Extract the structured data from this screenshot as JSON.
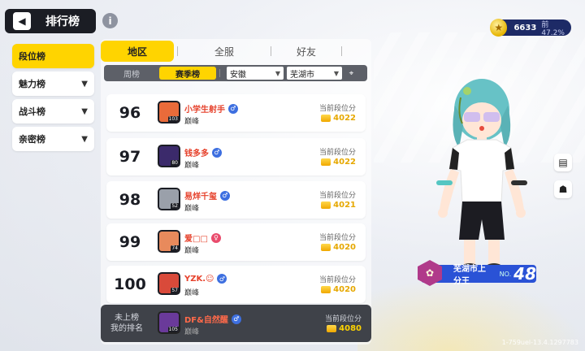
{
  "header": {
    "title": "排行榜",
    "back_icon": "arrow-left-icon",
    "info_icon": "info-icon"
  },
  "categories": [
    {
      "label": "段位榜",
      "active": true,
      "has_dropdown": false
    },
    {
      "label": "魅力榜",
      "active": false,
      "has_dropdown": true
    },
    {
      "label": "战斗榜",
      "active": false,
      "has_dropdown": true
    },
    {
      "label": "亲密榜",
      "active": false,
      "has_dropdown": true
    }
  ],
  "tabs": [
    {
      "label": "地区",
      "active": true
    },
    {
      "label": "全服",
      "active": false
    },
    {
      "label": "好友",
      "active": false
    }
  ],
  "filters": {
    "period": [
      {
        "label": "周榜",
        "active": false
      },
      {
        "label": "赛季榜",
        "active": true
      }
    ],
    "province": "安徽",
    "city": "芜湖市",
    "location_icon": "location-pin-icon"
  },
  "score_label": "当前段位分",
  "rows": [
    {
      "rank": "96",
      "name": "小学生射手",
      "gender": "male",
      "tier": "巅峰",
      "score": "4022",
      "level": "103",
      "avatar_color": "#e96b3a"
    },
    {
      "rank": "97",
      "name": "钱多多",
      "gender": "male",
      "tier": "巅峰",
      "score": "4022",
      "level": "80",
      "avatar_color": "#3b2a6b"
    },
    {
      "rank": "98",
      "name": "易烊千玺",
      "gender": "male",
      "tier": "巅峰",
      "score": "4021",
      "level": "52",
      "avatar_color": "#9aa0aa"
    },
    {
      "rank": "99",
      "name": "爱□□",
      "gender": "female",
      "tier": "巅峰",
      "score": "4020",
      "level": "74",
      "avatar_color": "#e88a5c"
    },
    {
      "rank": "100",
      "name": "YZK.☺",
      "gender": "male",
      "tier": "巅峰",
      "score": "4020",
      "level": "57",
      "avatar_color": "#d94a3a"
    }
  ],
  "my_rank": {
    "label_line1": "未上榜",
    "label_line2": "我的排名",
    "name": "DF&自然醒",
    "gender": "male",
    "tier": "巅峰",
    "score": "4080",
    "level": "105",
    "avatar_color": "#6a3a9a"
  },
  "currency": {
    "value": "6633",
    "percent": "前47.2%",
    "icon": "star-medal-icon"
  },
  "side_buttons": [
    {
      "icon": "document-icon"
    },
    {
      "icon": "ghost-icon"
    }
  ],
  "badge": {
    "title": "芜湖市上分王",
    "no_label": "NO.",
    "number": "48",
    "emblem_icon": "flower-emblem-icon"
  },
  "version": "1-759uel-13.4.1297783",
  "colors": {
    "accent": "#ffd400",
    "dark": "#1b1d24",
    "name_red": "#e6412b",
    "score_gold": "#e6a800",
    "badge_blue": "#2a52d6"
  }
}
